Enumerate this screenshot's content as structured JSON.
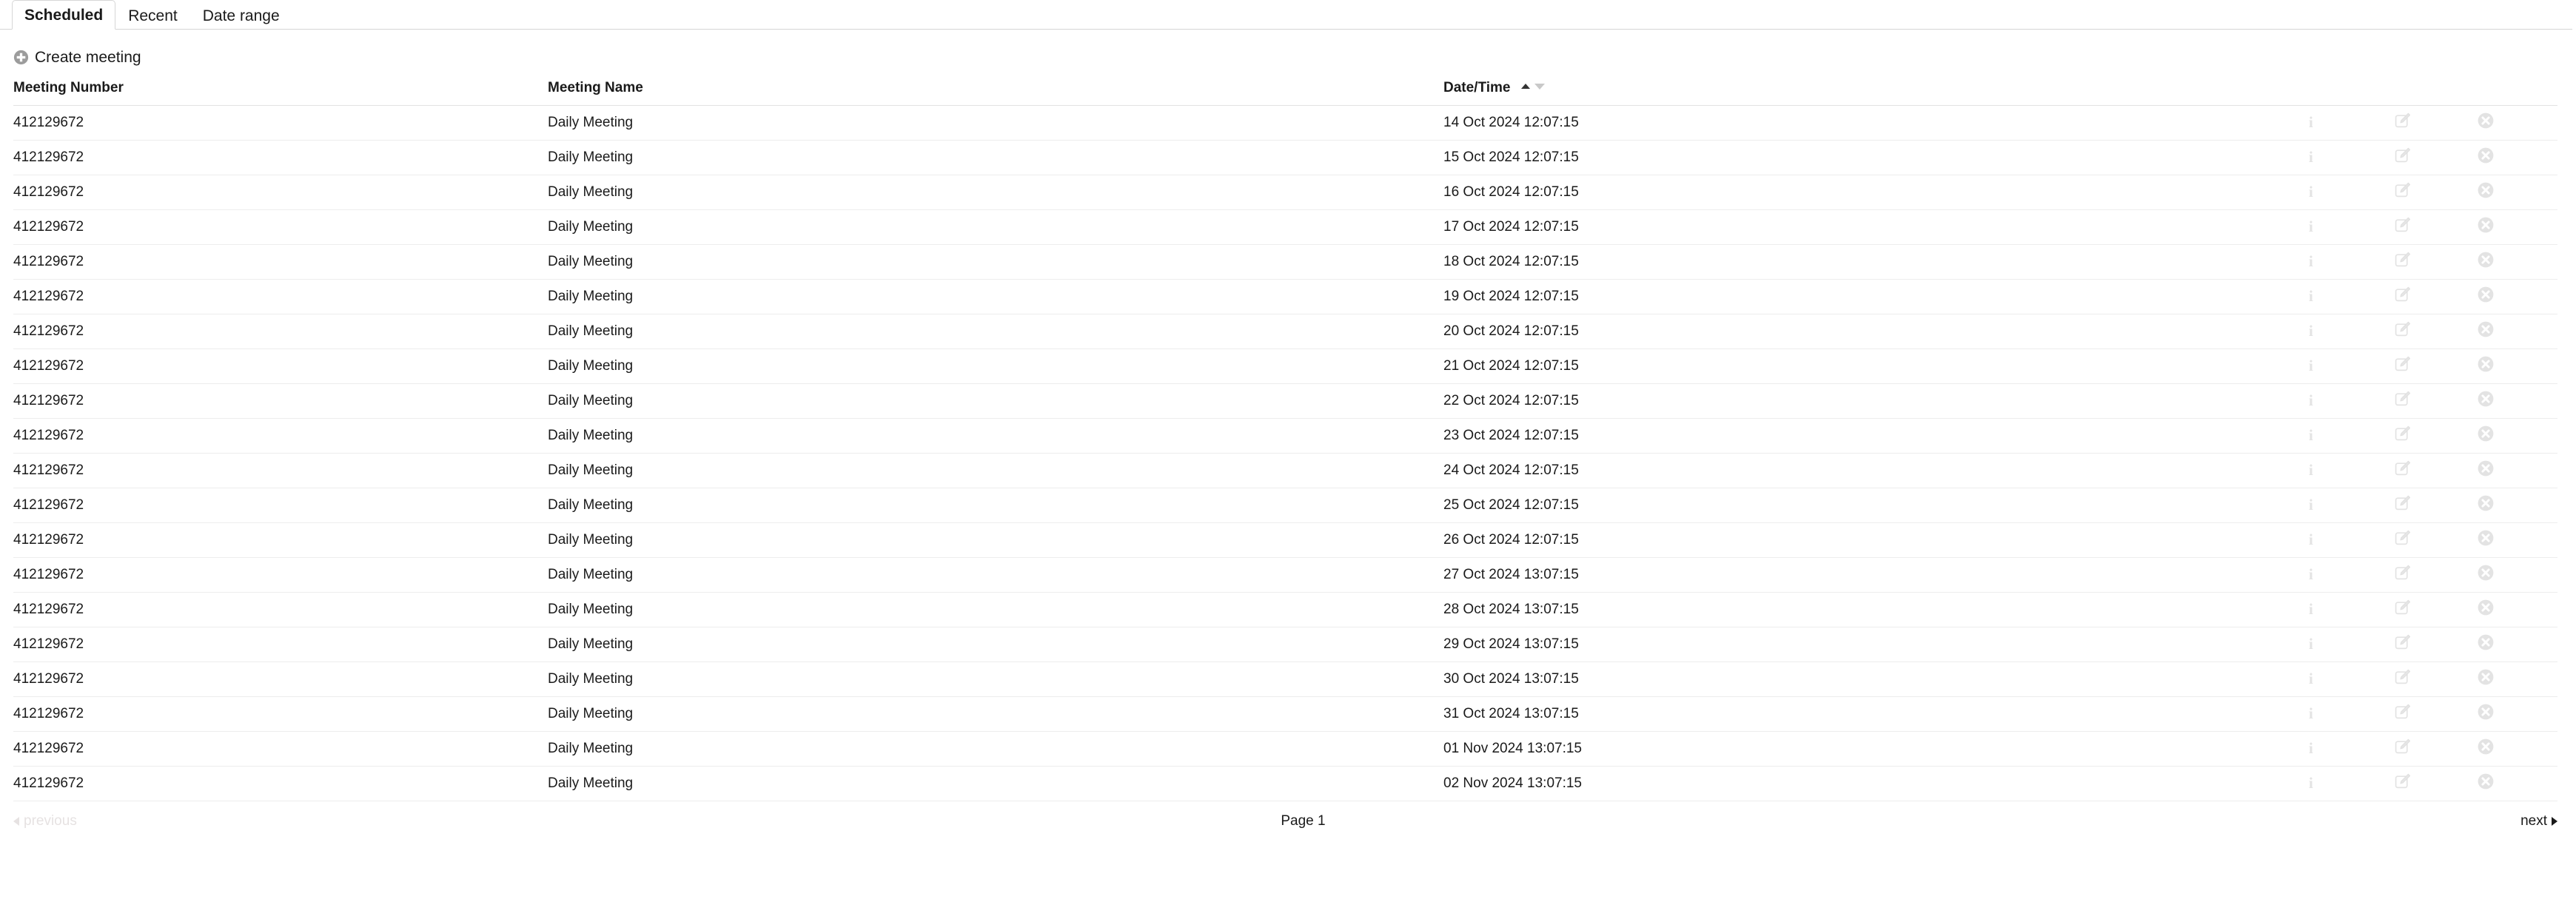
{
  "tabs": [
    {
      "label": "Scheduled",
      "active": true
    },
    {
      "label": "Recent",
      "active": false
    },
    {
      "label": "Date range",
      "active": false
    }
  ],
  "toolbar": {
    "create_meeting_label": "Create meeting",
    "create_meeting_icon": "plus-circle-icon"
  },
  "table": {
    "columns": [
      {
        "label": "Meeting Number",
        "key": "number",
        "sortable": true
      },
      {
        "label": "Meeting Name",
        "key": "name",
        "sortable": true
      },
      {
        "label": "Date/Time",
        "key": "datetime",
        "sortable": true,
        "sort": "asc"
      },
      {
        "label": "",
        "key": "info"
      },
      {
        "label": "",
        "key": "edit"
      },
      {
        "label": "",
        "key": "delete"
      }
    ],
    "row_action_icons": [
      "info-icon",
      "edit-icon",
      "delete-icon"
    ],
    "rows": [
      {
        "number": "412129672",
        "name": "Daily Meeting",
        "datetime": "14 Oct 2024 12:07:15"
      },
      {
        "number": "412129672",
        "name": "Daily Meeting",
        "datetime": "15 Oct 2024 12:07:15"
      },
      {
        "number": "412129672",
        "name": "Daily Meeting",
        "datetime": "16 Oct 2024 12:07:15"
      },
      {
        "number": "412129672",
        "name": "Daily Meeting",
        "datetime": "17 Oct 2024 12:07:15"
      },
      {
        "number": "412129672",
        "name": "Daily Meeting",
        "datetime": "18 Oct 2024 12:07:15"
      },
      {
        "number": "412129672",
        "name": "Daily Meeting",
        "datetime": "19 Oct 2024 12:07:15"
      },
      {
        "number": "412129672",
        "name": "Daily Meeting",
        "datetime": "20 Oct 2024 12:07:15"
      },
      {
        "number": "412129672",
        "name": "Daily Meeting",
        "datetime": "21 Oct 2024 12:07:15"
      },
      {
        "number": "412129672",
        "name": "Daily Meeting",
        "datetime": "22 Oct 2024 12:07:15"
      },
      {
        "number": "412129672",
        "name": "Daily Meeting",
        "datetime": "23 Oct 2024 12:07:15"
      },
      {
        "number": "412129672",
        "name": "Daily Meeting",
        "datetime": "24 Oct 2024 12:07:15"
      },
      {
        "number": "412129672",
        "name": "Daily Meeting",
        "datetime": "25 Oct 2024 12:07:15"
      },
      {
        "number": "412129672",
        "name": "Daily Meeting",
        "datetime": "26 Oct 2024 12:07:15"
      },
      {
        "number": "412129672",
        "name": "Daily Meeting",
        "datetime": "27 Oct 2024 13:07:15"
      },
      {
        "number": "412129672",
        "name": "Daily Meeting",
        "datetime": "28 Oct 2024 13:07:15"
      },
      {
        "number": "412129672",
        "name": "Daily Meeting",
        "datetime": "29 Oct 2024 13:07:15"
      },
      {
        "number": "412129672",
        "name": "Daily Meeting",
        "datetime": "30 Oct 2024 13:07:15"
      },
      {
        "number": "412129672",
        "name": "Daily Meeting",
        "datetime": "31 Oct 2024 13:07:15"
      },
      {
        "number": "412129672",
        "name": "Daily Meeting",
        "datetime": "01 Nov 2024 13:07:15"
      },
      {
        "number": "412129672",
        "name": "Daily Meeting",
        "datetime": "02 Nov 2024 13:07:15"
      }
    ]
  },
  "pager": {
    "previous_label": "previous",
    "previous_enabled": false,
    "page_label": "Page 1",
    "next_label": "next",
    "next_enabled": true
  },
  "colors": {
    "text": "#1a1a1a",
    "disabled_text": "#e6e2e2",
    "row_border": "#ededed",
    "header_border": "#e2e2e2",
    "tab_border": "#d6d6d6",
    "icon_gray": "#e3e3e3",
    "plus_circle": "#9c9c9c",
    "sort_active": "#333333",
    "sort_inactive": "#c9c9c9"
  }
}
